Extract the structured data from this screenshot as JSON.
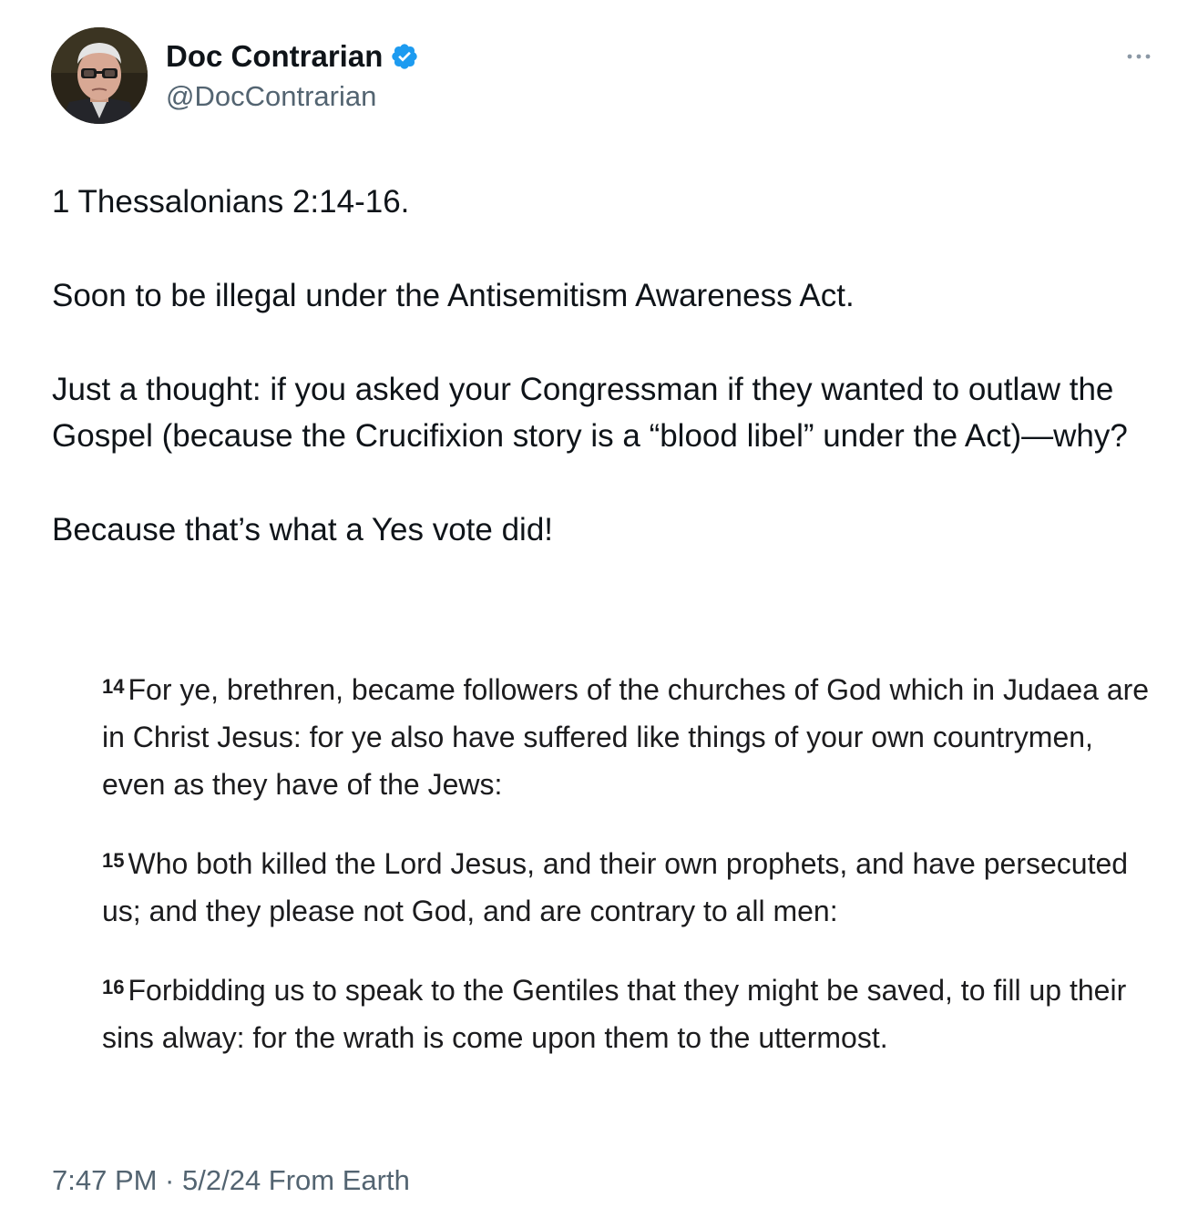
{
  "author": {
    "display_name": "Doc Contrarian",
    "handle": "@DocContrarian",
    "verified": true,
    "verified_color": "#1d9bf0"
  },
  "icons": {
    "avatar": "avatar-photo",
    "verified": "verified-badge-icon",
    "more": "more-options-icon"
  },
  "tweet": {
    "paragraphs": [
      "1 Thessalonians 2:14-16.",
      "Soon to be illegal under the Antisemitism Awareness Act.",
      "Just a thought: if you asked your Congressman if they wanted to outlaw the Gospel (because the Crucifixion story is a “blood libel” under the Act)—why?",
      "Because that’s what a Yes vote did!"
    ]
  },
  "media": {
    "verses": [
      {
        "number": "14",
        "text": "For ye, brethren, became followers of the churches of God which in Judaea are in Christ Jesus: for ye also have suffered like things of your own countrymen, even as they have of the Jews:"
      },
      {
        "number": "15",
        "text": "Who both killed the Lord Jesus, and their own prophets, and have persecuted us; and they please not God, and are contrary to all men:"
      },
      {
        "number": "16",
        "text": "Forbidding us to speak to the Gentiles that they might be saved, to fill up their sins alway: for the wrath is come upon them to the uttermost."
      }
    ]
  },
  "meta": {
    "timestamp": "7:47 PM · 5/2/24 From Earth"
  }
}
